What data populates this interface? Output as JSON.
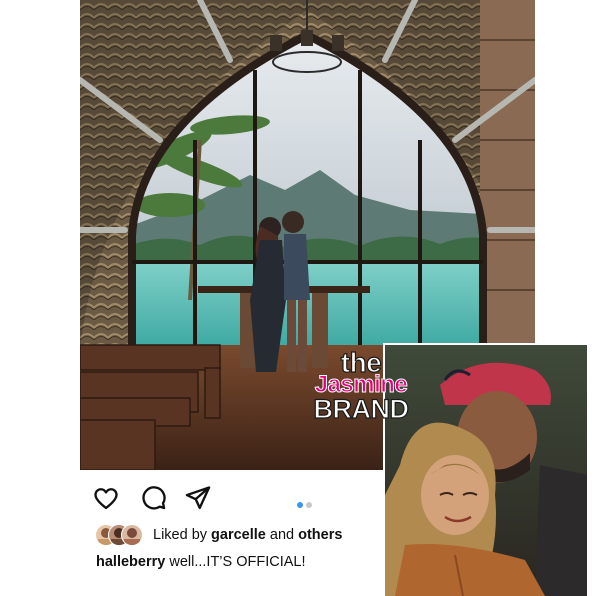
{
  "post": {
    "username": "halleberry",
    "caption_text": " well...IT’S OFFICIAL!",
    "likes": {
      "prefix": "Liked by ",
      "first_liker": "garcelle",
      "connector": " and ",
      "others": "others"
    },
    "carousel": {
      "total": 2,
      "active_index": 0,
      "active_color": "#3897f0",
      "inactive_color": "#c7c7c7"
    }
  },
  "icons": {
    "like": "heart-outline-icon",
    "comment": "comment-bubble-icon",
    "share": "paper-plane-icon"
  },
  "watermark": {
    "line1": "the",
    "line2": "Jasmine",
    "line3": "BRAND",
    "accent_color": "#e4007c"
  },
  "colors": {
    "text": "#111111",
    "lake": "#4fb6b0"
  }
}
